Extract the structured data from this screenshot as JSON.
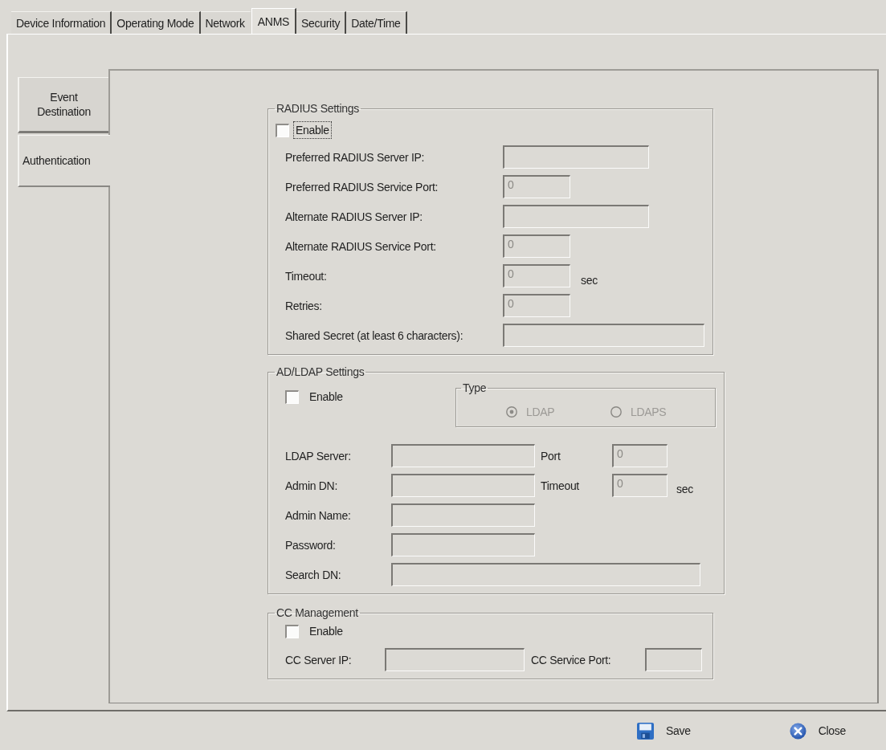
{
  "top_tabs": [
    {
      "label": "Device Information",
      "selected": false
    },
    {
      "label": "Operating Mode",
      "selected": false
    },
    {
      "label": "Network",
      "selected": false
    },
    {
      "label": "ANMS",
      "selected": true
    },
    {
      "label": "Security",
      "selected": false
    },
    {
      "label": "Date/Time",
      "selected": false
    }
  ],
  "side_tabs": [
    {
      "label": "Event Destination",
      "selected": false
    },
    {
      "label": "Authentication",
      "selected": true
    }
  ],
  "radius": {
    "title": "RADIUS Settings",
    "enable": {
      "label": "Enable",
      "checked": false,
      "focused": true
    },
    "fields": [
      {
        "label": "Preferred RADIUS Server IP:",
        "disabled": true
      },
      {
        "label": "Preferred RADIUS Service Port:",
        "value": "0",
        "disabled": true
      },
      {
        "label": "Alternate RADIUS Server IP:",
        "disabled": true
      },
      {
        "label": "Alternate RADIUS Service Port:",
        "value": "0",
        "disabled": true
      },
      {
        "label": "Timeout:",
        "value": "0",
        "unit": "sec",
        "disabled": true
      },
      {
        "label": "Retries:",
        "value": "0",
        "disabled": true
      },
      {
        "label": "Shared Secret (at least 6 characters):",
        "disabled": true
      }
    ]
  },
  "ldap": {
    "title": "AD/LDAP Settings",
    "enable": {
      "label": "Enable",
      "checked": false,
      "focused": false
    },
    "type": {
      "title": "Type",
      "options": [
        {
          "label": "LDAP",
          "selected": true,
          "disabled": true
        },
        {
          "label": "LDAPS",
          "selected": false,
          "disabled": true
        }
      ]
    },
    "rows": [
      {
        "fields": [
          {
            "label": "LDAP Server:",
            "disabled": true
          },
          {
            "label": "Port",
            "value": "0",
            "disabled": true
          }
        ]
      },
      {
        "fields": [
          {
            "label": "Admin DN:",
            "disabled": true
          },
          {
            "label": "Timeout",
            "value": "0",
            "unit": "sec",
            "disabled": true
          }
        ]
      },
      {
        "fields": [
          {
            "label": "Admin Name:",
            "disabled": true
          }
        ]
      },
      {
        "fields": [
          {
            "label": "Password:",
            "disabled": true
          }
        ]
      },
      {
        "fields": [
          {
            "label": "Search DN:",
            "disabled": true
          }
        ]
      }
    ]
  },
  "cc": {
    "title": "CC Management",
    "enable": {
      "label": "Enable",
      "checked": false,
      "focused": false
    },
    "fields": [
      {
        "label": "CC Server IP:",
        "disabled": true
      },
      {
        "label": "CC Service Port:",
        "disabled": true
      }
    ]
  },
  "buttons": [
    {
      "label": "Save",
      "kind": "save"
    },
    {
      "label": "Close",
      "kind": "close"
    }
  ]
}
